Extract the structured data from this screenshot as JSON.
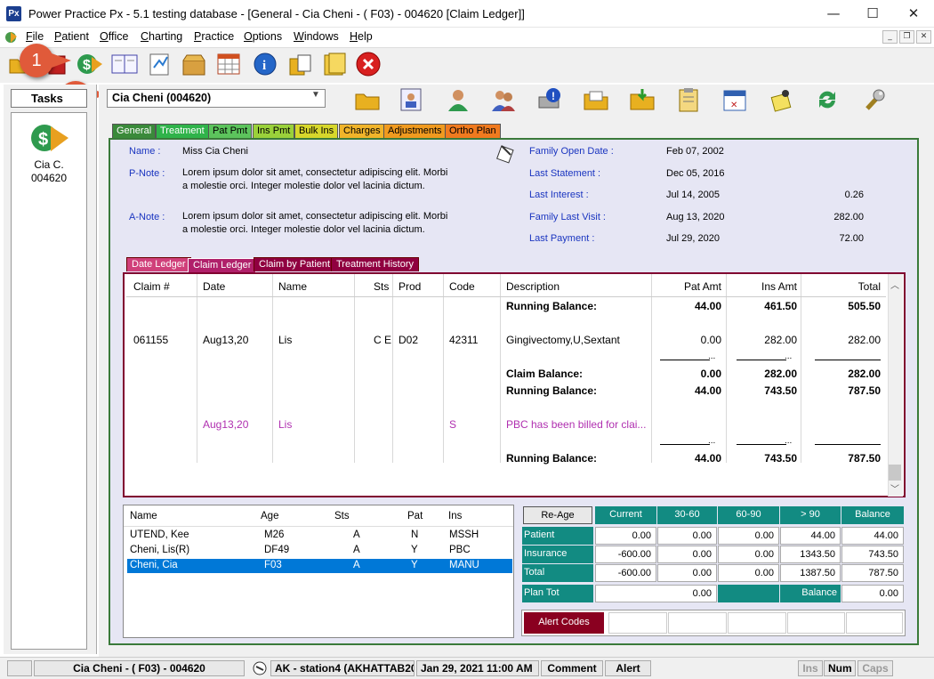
{
  "window": {
    "app_logo": "Px",
    "title": "Power Practice Px - 5.1 testing database - [General - Cia Cheni - ( F03) - 004620 [Claim Ledger]]",
    "minimize": "—",
    "maximize": "☐",
    "close": "✕"
  },
  "menu": {
    "items": [
      {
        "label": "File",
        "accel": "F",
        "rest": "ile"
      },
      {
        "label": "Patient",
        "accel": "P",
        "rest": "atient"
      },
      {
        "label": "Office",
        "accel": "O",
        "rest": "ffice"
      },
      {
        "label": "Charting",
        "accel": "C",
        "rest": "harting"
      },
      {
        "label": "Practice",
        "accel": "P",
        "rest": "ractice"
      },
      {
        "label": "Options",
        "accel": "O",
        "rest": "ptions"
      },
      {
        "label": "Windows",
        "accel": "W",
        "rest": "indows"
      },
      {
        "label": "Help",
        "accel": "H",
        "rest": "elp"
      }
    ],
    "mdi_min": "_",
    "mdi_restore": "❐",
    "mdi_close": "✕"
  },
  "callouts": {
    "one": "1",
    "two": "2"
  },
  "sidebar": {
    "task_tab": "Tasks",
    "patient_short": "Cia C.",
    "patient_id": "004620"
  },
  "patient_select": {
    "value": "Cia Cheni (004620)"
  },
  "tabs": [
    {
      "label": "General",
      "color": "#3a8a3a"
    },
    {
      "label": "Treatment",
      "color": "#2fb34a"
    },
    {
      "label": "Pat Pmt",
      "color": "#5cc45c"
    },
    {
      "label": "Ins Pmt",
      "color": "#9ad13a"
    },
    {
      "label": "Bulk Ins",
      "color": "#d7d72b"
    },
    {
      "label": "Charges",
      "color": "#f0b42a"
    },
    {
      "label": "Adjustments",
      "color": "#f09a1f"
    },
    {
      "label": "Ortho Plan",
      "color": "#f07a1f"
    }
  ],
  "general": {
    "name_label": "Name :",
    "name_value": "Miss Cia Cheni",
    "pnote_label": "P-Note :",
    "pnote_text": "Lorem ipsum dolor sit amet, consectetur adipiscing elit. Morbi a molestie orci. Integer molestie dolor vel lacinia dictum. Integer sem ligula, fringilla et magna sed, mattis dapibus arcu.",
    "anote_label": "A-Note :",
    "anote_text": "Lorem ipsum dolor sit amet, consectetur adipiscing elit. Morbi a molestie orci. Integer molestie dolor vel lacinia dictum. Integer sem ligula, fringilla et magna sed, mattis dapibus arcu.",
    "family_open_date_label": "Family Open Date :",
    "family_open_date": "Feb 07, 2002",
    "last_statement_label": "Last Statement :",
    "last_statement": "Dec 05, 2016",
    "last_interest_label": "Last Interest :",
    "last_interest_date": "Jul 14, 2005",
    "last_interest_amt": "0.26",
    "family_last_visit_label": "Family Last Visit :",
    "family_last_visit_date": "Aug 13, 2020",
    "family_last_visit_amt": "282.00",
    "last_payment_label": "Last Payment :",
    "last_payment_date": "Jul 29, 2020",
    "last_payment_amt": "72.00"
  },
  "ledger_tabs": [
    {
      "label": "Date Ledger",
      "color": "#d0407a"
    },
    {
      "label": "Claim Ledger",
      "color": "#b0206a"
    },
    {
      "label": "Claim by Patient",
      "color": "#900040"
    },
    {
      "label": "Treatment History",
      "color": "#900040"
    }
  ],
  "ledger": {
    "headers": [
      "Claim #",
      "Date",
      "Name",
      "Sts",
      "Prod",
      "Code",
      "Description",
      "Pat Amt",
      "Ins Amt",
      "Total"
    ],
    "running1": {
      "desc": "Running Balance:",
      "pat": "44.00",
      "ins": "461.50",
      "total": "505.50"
    },
    "row1": {
      "claim": "061155",
      "date": "Aug13,20",
      "name": "Lis",
      "sts": "C E",
      "prod": "D02",
      "code": "42311",
      "desc": "Gingivectomy,U,Sextant",
      "pat": "0.00",
      "ins": "282.00",
      "total": "282.00"
    },
    "dash1": {
      "pat": "...",
      "ins": "...",
      "total": ""
    },
    "claim_balance": {
      "desc": "Claim Balance:",
      "pat": "0.00",
      "ins": "282.00",
      "total": "282.00"
    },
    "running2": {
      "desc": "Running Balance:",
      "pat": "44.00",
      "ins": "743.50",
      "total": "787.50"
    },
    "row2": {
      "date": "Aug13,20",
      "name": "Lis",
      "code": "S",
      "desc": "PBC has been billed for clai..."
    },
    "dash2": {
      "pat": "...",
      "ins": "...",
      "total": ""
    },
    "running3": {
      "desc": "Running Balance:",
      "pat": "44.00",
      "ins": "743.50",
      "total": "787.50"
    }
  },
  "family": {
    "headers": [
      "Name",
      "Age",
      "Sts",
      "Pat",
      "Ins"
    ],
    "rows": [
      {
        "name": "UTEND, Kee",
        "age": "M26",
        "sts": "A",
        "pat": "N",
        "ins": "MSSH"
      },
      {
        "name": "Cheni, Lis(R)",
        "age": "DF49",
        "sts": "A",
        "pat": "Y",
        "ins": "PBC"
      },
      {
        "name": "Cheni, Cia",
        "age": "F03",
        "sts": "A",
        "pat": "Y",
        "ins": "MANU"
      }
    ]
  },
  "balance": {
    "reage_label": "Re-Age",
    "headers": [
      "Current",
      "30-60",
      "60-90",
      "> 90",
      "Balance"
    ],
    "rows": [
      {
        "label": "Patient",
        "values": [
          "0.00",
          "0.00",
          "0.00",
          "44.00",
          "44.00"
        ]
      },
      {
        "label": "Insurance",
        "values": [
          "-600.00",
          "0.00",
          "0.00",
          "1343.50",
          "743.50"
        ]
      },
      {
        "label": "Total",
        "values": [
          "-600.00",
          "0.00",
          "0.00",
          "1387.50",
          "787.50"
        ]
      }
    ],
    "plan_tot_label": "Plan Tot",
    "plan_tot_value": "0.00",
    "balance_label": "Balance",
    "balance_value": "0.00",
    "alert_codes_label": "Alert Codes"
  },
  "statusbar": {
    "patient": "Cia Cheni - ( F03) - 004620",
    "station": "AK - station4 (AKHATTAB20",
    "datetime": "Jan 29, 2021 11:00 AM",
    "comment": "Comment",
    "alert": "Alert",
    "ins": "Ins",
    "num": "Num",
    "caps": "Caps"
  },
  "colors": {
    "accent_teal": "#128b82",
    "ledger_border": "#800030",
    "selected_row": "#0078d7",
    "pbc_magenta": "#b030b0"
  }
}
